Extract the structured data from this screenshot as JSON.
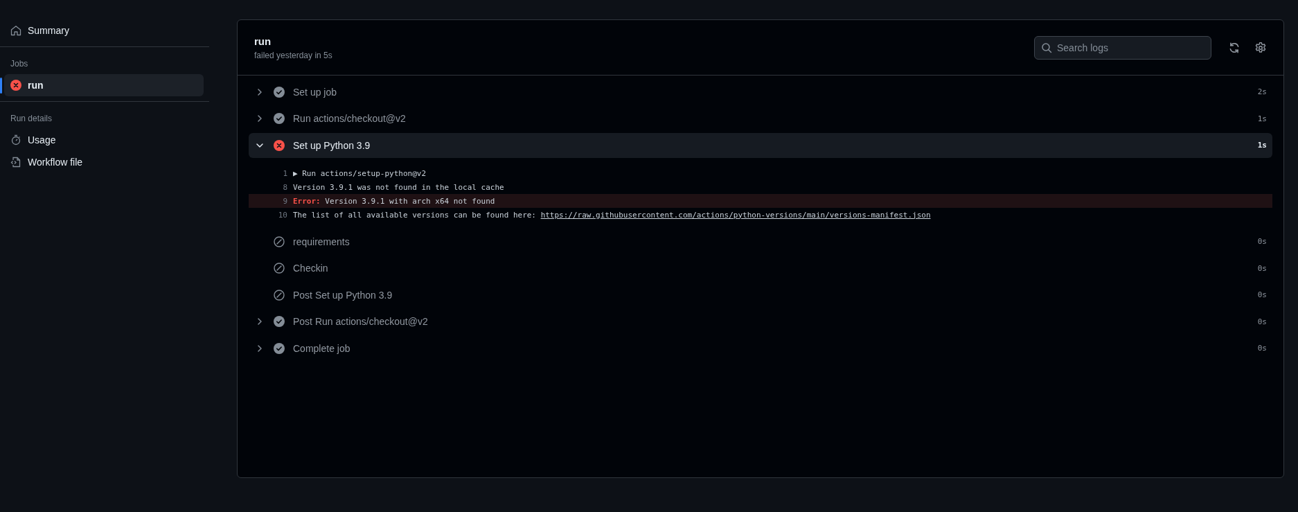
{
  "sidebar": {
    "summary": {
      "label": "Summary",
      "selected": false
    },
    "jobs_heading": "Jobs",
    "jobs": [
      {
        "label": "run",
        "kind": "failure",
        "selected": true
      }
    ],
    "run_details_heading": "Run details",
    "details": [
      {
        "label": "Usage",
        "kind": "usage"
      },
      {
        "label": "Workflow file",
        "kind": "file"
      }
    ]
  },
  "job": {
    "title": "run",
    "subtitle": "failed yesterday in 5s",
    "search": {
      "placeholder": "Search logs"
    },
    "steps": [
      {
        "name": "Set up job",
        "duration": "2s",
        "kind": "success",
        "expanded": false
      },
      {
        "name": "Run actions/checkout@v2",
        "duration": "1s",
        "kind": "success",
        "expanded": false
      },
      {
        "name": "Set up Python 3.9",
        "duration": "1s",
        "kind": "failure",
        "expanded": true,
        "log": [
          {
            "number": "1",
            "kind": "group",
            "marker": "▶",
            "text": "Run actions/setup-python@v2"
          },
          {
            "number": "8",
            "kind": "plain",
            "text": "Version 3.9.1 was not found in the local cache"
          },
          {
            "number": "9",
            "kind": "error",
            "label": "Error:",
            "text": "Version 3.9.1 with arch x64 not found"
          },
          {
            "number": "10",
            "kind": "plain",
            "text": "The list of all available versions can be found here:",
            "link": "https://raw.githubusercontent.com/actions/python-versions/main/versions-manifest.json"
          }
        ]
      },
      {
        "name": "requirements",
        "duration": "0s",
        "kind": "skipped",
        "expanded": false
      },
      {
        "name": "Checkin",
        "duration": "0s",
        "kind": "skipped",
        "expanded": false
      },
      {
        "name": "Post Set up Python 3.9",
        "duration": "0s",
        "kind": "skipped",
        "expanded": false
      },
      {
        "name": "Post Run actions/checkout@v2",
        "duration": "0s",
        "kind": "success",
        "expanded": false
      },
      {
        "name": "Complete job",
        "duration": "0s",
        "kind": "success",
        "expanded": false
      }
    ]
  }
}
